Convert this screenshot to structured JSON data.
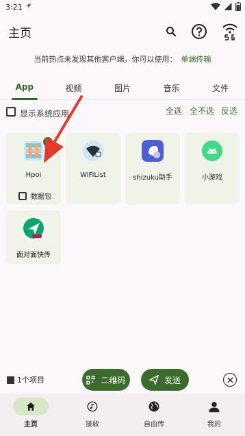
{
  "status_bar": {
    "time": "3:21"
  },
  "app_bar": {
    "title": "主页"
  },
  "hint": {
    "text": "当前热点未发现其他客户端，你可以使用：",
    "link": "单端传输"
  },
  "tabs": [
    {
      "label": "App",
      "active": true
    },
    {
      "label": "视频",
      "active": false
    },
    {
      "label": "图片",
      "active": false
    },
    {
      "label": "音乐",
      "active": false
    },
    {
      "label": "文件",
      "active": false
    }
  ],
  "select_bar": {
    "show_system": "显示系统应用",
    "select_all": "全选",
    "select_none": "全不选",
    "invert": "反选"
  },
  "apps": [
    {
      "label": "Hpoi",
      "selected": true,
      "pkg_label": "数据包"
    },
    {
      "label": "WiFiList"
    },
    {
      "label": "shizuku助手"
    },
    {
      "label": "小游戏"
    },
    {
      "label": "面对面快传"
    }
  ],
  "bottom_actions": {
    "count": "1个项目",
    "qr": "二维码",
    "send": "发送"
  },
  "bottom_nav": [
    {
      "label": "主页",
      "active": true
    },
    {
      "label": "接收",
      "active": false
    },
    {
      "label": "自由传",
      "active": false
    },
    {
      "label": "我的",
      "active": false
    }
  ],
  "colors": {
    "accent": "#3b6c2b",
    "arrow": "#e53a2b",
    "background": "#fcf7fb",
    "tile": "#f0f3e8"
  }
}
